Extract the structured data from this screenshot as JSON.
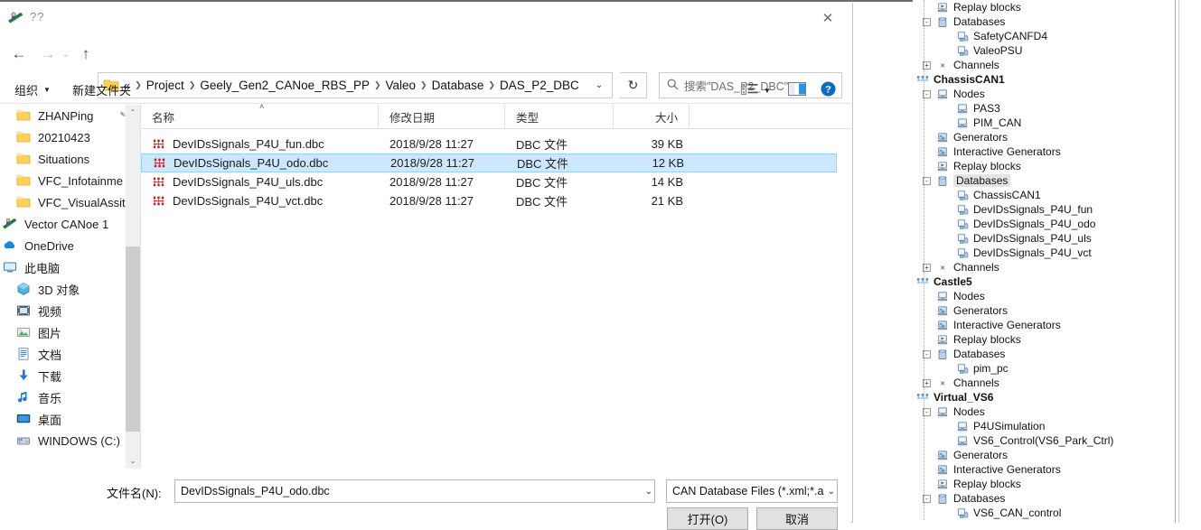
{
  "window": {
    "title": "??",
    "title_icon": "vector-canoe-icon",
    "close_label": "✕"
  },
  "nav": {
    "back_icon": "←",
    "forward_icon": "→",
    "recent_icon": "⌄",
    "up_icon": "↑",
    "refresh_icon": "↻",
    "breadcrumb_prefix": "«",
    "breadcrumb": [
      "Project",
      "Geely_Gen2_CANoe_RBS_PP",
      "Valeo",
      "Database",
      "DAS_P2_DBC"
    ],
    "address_dropdown_icon": "⌄",
    "search_icon": "⚲",
    "search_placeholder": "搜索\"DAS_P2_DBC\""
  },
  "commandbar": {
    "organize": "组织",
    "organize_caret": "▼",
    "new_folder": "新建文件夹",
    "view_icon": "view-list-icon",
    "view_caret": "▼",
    "pane_icon": "preview-pane-icon",
    "help_icon": "?"
  },
  "navpane": {
    "items": [
      {
        "label": "ZHANPing",
        "icon": "folder-icon",
        "pinned": true,
        "indent": 1
      },
      {
        "label": "20210423",
        "icon": "folder-icon",
        "pinned": false,
        "indent": 1
      },
      {
        "label": "Situations",
        "icon": "folder-icon",
        "pinned": false,
        "indent": 1
      },
      {
        "label": "VFC_Infotainme",
        "icon": "folder-icon",
        "pinned": false,
        "indent": 1
      },
      {
        "label": "VFC_VisualAssit",
        "icon": "folder-icon",
        "pinned": false,
        "indent": 1
      },
      {
        "label": "Vector CANoe 1",
        "icon": "vector-canoe-icon",
        "pinned": false,
        "indent": 0
      },
      {
        "label": "OneDrive",
        "icon": "onedrive-cloud-icon",
        "pinned": false,
        "indent": 0
      },
      {
        "label": "此电脑",
        "icon": "this-pc-icon",
        "pinned": false,
        "indent": 0
      },
      {
        "label": "3D 对象",
        "icon": "3d-objects-icon",
        "pinned": false,
        "indent": 1
      },
      {
        "label": "视频",
        "icon": "videos-icon",
        "pinned": false,
        "indent": 1
      },
      {
        "label": "图片",
        "icon": "pictures-icon",
        "pinned": false,
        "indent": 1
      },
      {
        "label": "文档",
        "icon": "documents-icon",
        "pinned": false,
        "indent": 1
      },
      {
        "label": "下载",
        "icon": "downloads-icon",
        "pinned": false,
        "indent": 1
      },
      {
        "label": "音乐",
        "icon": "music-icon",
        "pinned": false,
        "indent": 1
      },
      {
        "label": "桌面",
        "icon": "desktop-icon",
        "pinned": false,
        "indent": 1
      },
      {
        "label": "WINDOWS (C:)",
        "icon": "drive-icon",
        "pinned": false,
        "indent": 1
      }
    ],
    "scroll_up_icon": "⌃",
    "scroll_down_icon": "⌄"
  },
  "filelist": {
    "columns": [
      {
        "key": "name",
        "label": "名称",
        "sorted": "asc"
      },
      {
        "key": "date",
        "label": "修改日期"
      },
      {
        "key": "type",
        "label": "类型"
      },
      {
        "key": "size",
        "label": "大小"
      }
    ],
    "sort_caret": "˄",
    "rows": [
      {
        "name": "DevIDsSignals_P4U_fun.dbc",
        "date": "2018/9/28 11:27",
        "type": "DBC 文件",
        "size": "39 KB",
        "selected": false,
        "icon": "dbc-file-icon"
      },
      {
        "name": "DevIDsSignals_P4U_odo.dbc",
        "date": "2018/9/28 11:27",
        "type": "DBC 文件",
        "size": "12 KB",
        "selected": true,
        "icon": "dbc-file-icon"
      },
      {
        "name": "DevIDsSignals_P4U_uls.dbc",
        "date": "2018/9/28 11:27",
        "type": "DBC 文件",
        "size": "14 KB",
        "selected": false,
        "icon": "dbc-file-icon"
      },
      {
        "name": "DevIDsSignals_P4U_vct.dbc",
        "date": "2018/9/28 11:27",
        "type": "DBC 文件",
        "size": "21 KB",
        "selected": false,
        "icon": "dbc-file-icon"
      }
    ]
  },
  "footer": {
    "filename_label": "文件名(N):",
    "filename_value": "DevIDsSignals_P4U_odo.dbc",
    "filename_dropdown_icon": "⌄",
    "filetype_value": "CAN Database Files (*.xml;*.a",
    "filetype_dropdown_icon": "⌄",
    "open_button": "打开(O)",
    "cancel_button": "取消"
  },
  "tree": {
    "rows": [
      {
        "label": "Replay blocks",
        "depth": 2,
        "icon": "replay-block-icon",
        "toggle": null,
        "bold": false,
        "highlight": false
      },
      {
        "label": "Databases",
        "depth": 2,
        "icon": "database-icon",
        "toggle": "-",
        "bold": false,
        "highlight": false
      },
      {
        "label": "SafetyCANFD4",
        "depth": 3,
        "icon": "xml-db-icon",
        "toggle": null,
        "bold": false,
        "highlight": false
      },
      {
        "label": "ValeoPSU",
        "depth": 3,
        "icon": "dbc-db-icon",
        "toggle": null,
        "bold": false,
        "highlight": false
      },
      {
        "label": "Channels",
        "depth": 2,
        "icon": "channels-icon",
        "toggle": "+",
        "bold": false,
        "highlight": false
      },
      {
        "label": "ChassisCAN1",
        "depth": 1,
        "icon": "bus-icon",
        "toggle": null,
        "bold": true,
        "highlight": false
      },
      {
        "label": "Nodes",
        "depth": 2,
        "icon": "node-icon",
        "toggle": "-",
        "bold": false,
        "highlight": false
      },
      {
        "label": "PAS3",
        "depth": 3,
        "icon": "node-small-icon",
        "toggle": null,
        "bold": false,
        "highlight": false
      },
      {
        "label": "PIM_CAN",
        "depth": 3,
        "icon": "node-small-icon",
        "toggle": null,
        "bold": false,
        "highlight": false
      },
      {
        "label": "Generators",
        "depth": 2,
        "icon": "generator-icon",
        "toggle": null,
        "bold": false,
        "highlight": false
      },
      {
        "label": "Interactive Generators",
        "depth": 2,
        "icon": "generator-icon",
        "toggle": null,
        "bold": false,
        "highlight": false
      },
      {
        "label": "Replay blocks",
        "depth": 2,
        "icon": "replay-block-icon",
        "toggle": null,
        "bold": false,
        "highlight": false
      },
      {
        "label": "Databases",
        "depth": 2,
        "icon": "database-icon",
        "toggle": "-",
        "bold": false,
        "highlight": true
      },
      {
        "label": "ChassisCAN1",
        "depth": 3,
        "icon": "xml-db-icon",
        "toggle": null,
        "bold": false,
        "highlight": false
      },
      {
        "label": "DevIDsSignals_P4U_fun",
        "depth": 3,
        "icon": "dbc-db-icon",
        "toggle": null,
        "bold": false,
        "highlight": false
      },
      {
        "label": "DevIDsSignals_P4U_odo",
        "depth": 3,
        "icon": "dbc-db-icon",
        "toggle": null,
        "bold": false,
        "highlight": false
      },
      {
        "label": "DevIDsSignals_P4U_uls",
        "depth": 3,
        "icon": "dbc-db-icon",
        "toggle": null,
        "bold": false,
        "highlight": false
      },
      {
        "label": "DevIDsSignals_P4U_vct",
        "depth": 3,
        "icon": "dbc-db-icon",
        "toggle": null,
        "bold": false,
        "highlight": false
      },
      {
        "label": "Channels",
        "depth": 2,
        "icon": "channels-icon",
        "toggle": "+",
        "bold": false,
        "highlight": false
      },
      {
        "label": "Castle5",
        "depth": 1,
        "icon": "bus-icon",
        "toggle": null,
        "bold": true,
        "highlight": false
      },
      {
        "label": "Nodes",
        "depth": 2,
        "icon": "node-icon",
        "toggle": null,
        "bold": false,
        "highlight": false
      },
      {
        "label": "Generators",
        "depth": 2,
        "icon": "generator-icon",
        "toggle": null,
        "bold": false,
        "highlight": false
      },
      {
        "label": "Interactive Generators",
        "depth": 2,
        "icon": "generator-icon",
        "toggle": null,
        "bold": false,
        "highlight": false
      },
      {
        "label": "Replay blocks",
        "depth": 2,
        "icon": "replay-block-icon",
        "toggle": null,
        "bold": false,
        "highlight": false
      },
      {
        "label": "Databases",
        "depth": 2,
        "icon": "database-icon",
        "toggle": "-",
        "bold": false,
        "highlight": false
      },
      {
        "label": "pim_pc",
        "depth": 3,
        "icon": "dbc-db-icon",
        "toggle": null,
        "bold": false,
        "highlight": false
      },
      {
        "label": "Channels",
        "depth": 2,
        "icon": "channels-icon",
        "toggle": "+",
        "bold": false,
        "highlight": false
      },
      {
        "label": "Virtual_VS6",
        "depth": 1,
        "icon": "bus-icon",
        "toggle": null,
        "bold": true,
        "highlight": false
      },
      {
        "label": "Nodes",
        "depth": 2,
        "icon": "node-icon",
        "toggle": "-",
        "bold": false,
        "highlight": false
      },
      {
        "label": "P4USimulation",
        "depth": 3,
        "icon": "node-small-icon",
        "toggle": null,
        "bold": false,
        "highlight": false
      },
      {
        "label": "VS6_Control(VS6_Park_Ctrl)",
        "depth": 3,
        "icon": "node-small-icon",
        "toggle": null,
        "bold": false,
        "highlight": false
      },
      {
        "label": "Generators",
        "depth": 2,
        "icon": "generator-icon",
        "toggle": null,
        "bold": false,
        "highlight": false
      },
      {
        "label": "Interactive Generators",
        "depth": 2,
        "icon": "generator-icon",
        "toggle": null,
        "bold": false,
        "highlight": false
      },
      {
        "label": "Replay blocks",
        "depth": 2,
        "icon": "replay-block-icon",
        "toggle": null,
        "bold": false,
        "highlight": false
      },
      {
        "label": "Databases",
        "depth": 2,
        "icon": "database-icon",
        "toggle": "-",
        "bold": false,
        "highlight": false
      },
      {
        "label": "VS6_CAN_control",
        "depth": 3,
        "icon": "dbc-db-icon",
        "toggle": null,
        "bold": false,
        "highlight": false
      }
    ]
  },
  "colors": {
    "selection": "#cce8ff",
    "selection_border": "#99d1ff",
    "folder_yellow": "#ffd357",
    "dbc_red": "#c21b1b",
    "accent_blue": "#0b6bbd",
    "tree_icon_blue": "#7a9fc4"
  }
}
